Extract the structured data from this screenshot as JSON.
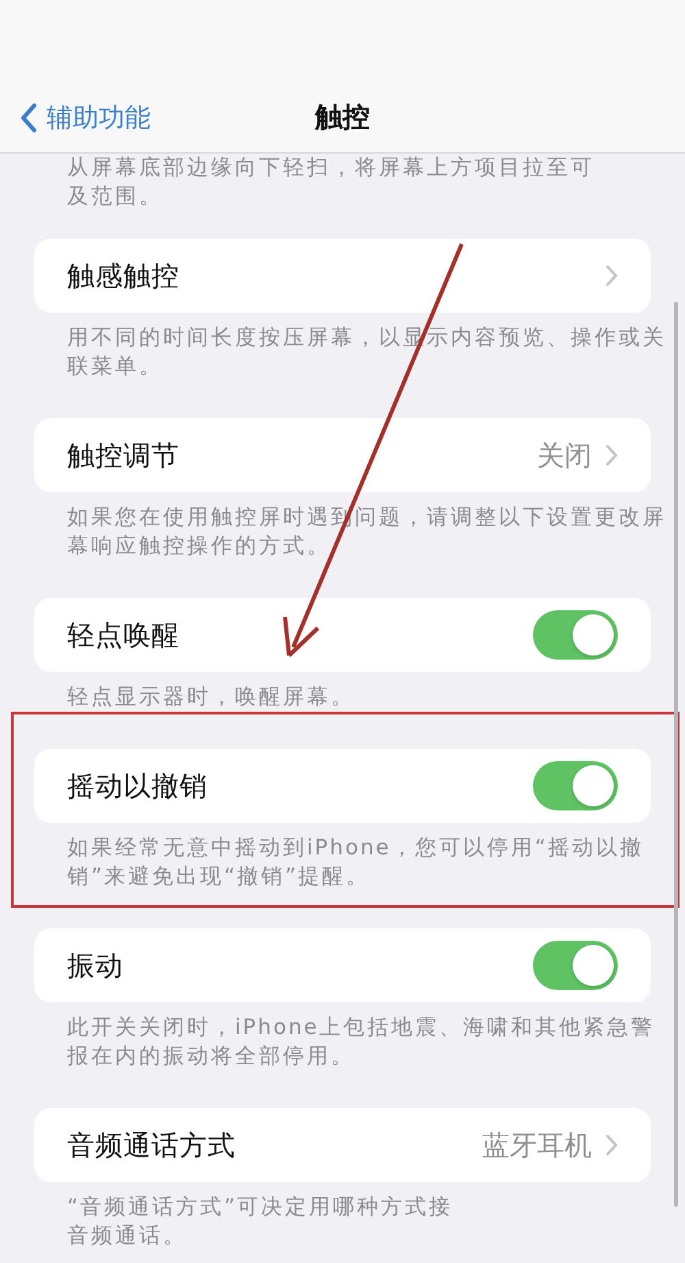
{
  "nav": {
    "back": "辅助功能",
    "title": "触控"
  },
  "top_footer": [
    "从屏幕底部边缘向下轻扫，将屏幕上方项目拉至可",
    "及范围。"
  ],
  "items": [
    {
      "kind": "disclosure",
      "label": "触感触控",
      "highlighted": false,
      "footer": [
        "用不同的时间长度按压屏幕，以显示内容预览、操作或关",
        "联菜单。"
      ]
    },
    {
      "kind": "disclosure",
      "label": "触控调节",
      "value": "关闭",
      "highlighted": false,
      "footer": [
        "如果您在使用触控屏时遇到问题，请调整以下设置更改屏",
        "幕响应触控操作的方式。"
      ]
    },
    {
      "kind": "toggle",
      "label": "轻点唤醒",
      "on": true,
      "highlighted": false,
      "footer": [
        "轻点显示器时，唤醒屏幕。"
      ]
    },
    {
      "kind": "toggle",
      "label": "摇动以撤销",
      "on": true,
      "highlighted": true,
      "footer": [
        "如果经常无意中摇动到iPhone，您可以停用“摇动以撤",
        "销”来避免出现“撤销”提醒。"
      ]
    },
    {
      "kind": "toggle",
      "label": "振动",
      "on": true,
      "highlighted": false,
      "footer": [
        "此开关关闭时，iPhone上包括地震、海啸和其他紧急警",
        "报在内的振动将全部停用。"
      ]
    },
    {
      "kind": "disclosure",
      "label": "音频通话方式",
      "value": "蓝牙耳机",
      "highlighted": false,
      "footer": [
        "“音频通话方式”可决定用哪种方式接",
        "音频通话。"
      ]
    }
  ]
}
